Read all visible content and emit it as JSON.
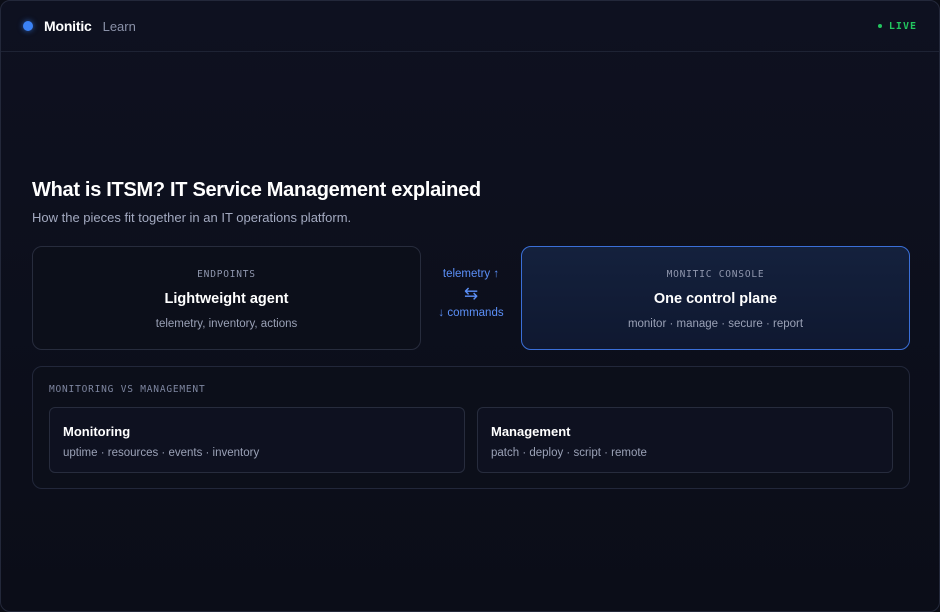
{
  "header": {
    "brand": "Monitic",
    "section": "Learn",
    "status": "LIVE",
    "accent_color": "#3b82f6",
    "status_color": "#22c55e"
  },
  "hero": {
    "title": "What is ITSM? IT Service Management explained",
    "subtitle": "How the pieces fit together in an IT operations platform."
  },
  "diagram": {
    "endpoints": {
      "kicker": "ENDPOINTS",
      "title": "Lightweight agent",
      "description": "telemetry, inventory, actions"
    },
    "flow": {
      "up_label": "telemetry ↑",
      "icon": "⇆",
      "down_label": "↓ commands"
    },
    "console": {
      "kicker": "MONITIC CONSOLE",
      "title": "One control plane",
      "description": "monitor · manage · secure · report"
    }
  },
  "comparison": {
    "kicker": "MONITORING VS MANAGEMENT",
    "items": [
      {
        "title": "Monitoring",
        "description": "uptime · resources · events · inventory"
      },
      {
        "title": "Management",
        "description": "patch · deploy · script · remote"
      }
    ]
  }
}
